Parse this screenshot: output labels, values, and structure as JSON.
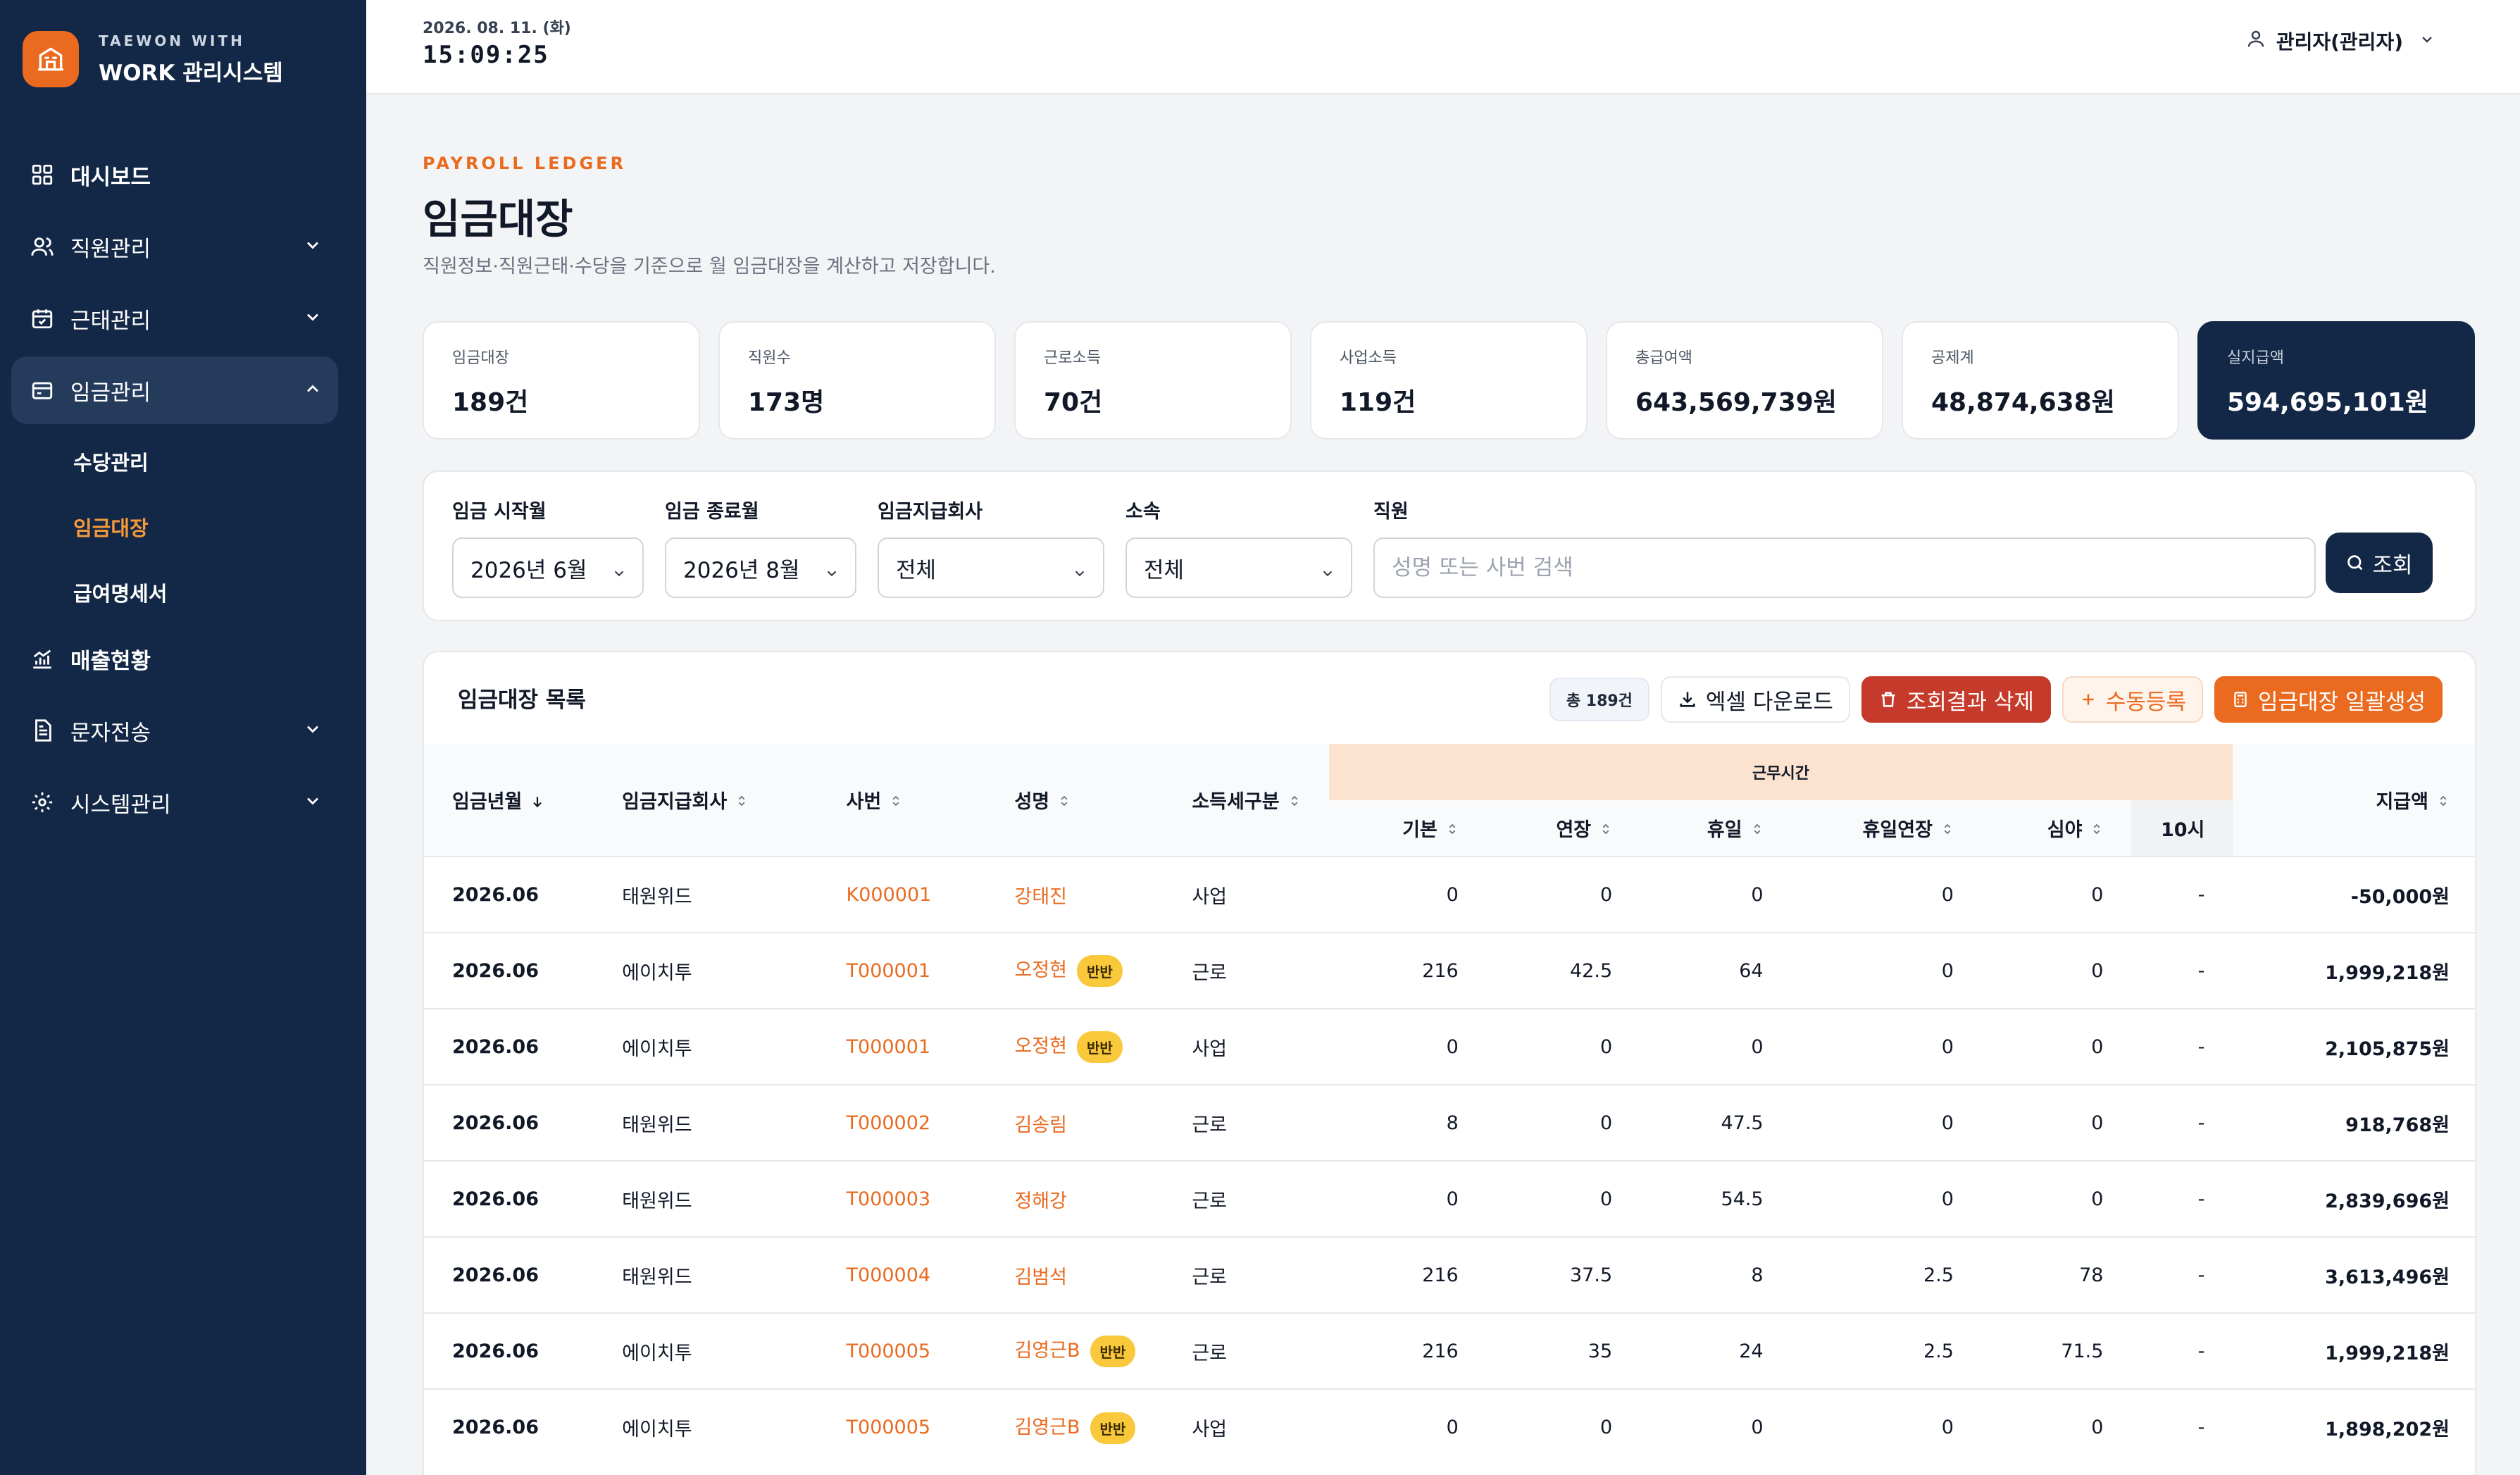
{
  "brand": {
    "sub": "TAEWON WITH",
    "title": "WORK 관리시스템"
  },
  "nav": {
    "dashboard": "대시보드",
    "employees": "직원관리",
    "attendance": "근태관리",
    "payroll": "임금관리",
    "payroll_sub": [
      "수당관리",
      "임금대장",
      "급여명세서"
    ],
    "sales": "매출현황",
    "sms": "문자전송",
    "system": "시스템관리"
  },
  "topbar": {
    "date": "2026. 08. 11. (화)",
    "time": "15:09:25",
    "user": "관리자(관리자)"
  },
  "header": {
    "eyebrow": "PAYROLL LEDGER",
    "title": "임금대장",
    "desc": "직원정보·직원근태·수당을 기준으로 월 임금대장을 계산하고 저장합니다."
  },
  "stats": [
    {
      "label": "임금대장",
      "value": "189건"
    },
    {
      "label": "직원수",
      "value": "173명"
    },
    {
      "label": "근로소득",
      "value": "70건"
    },
    {
      "label": "사업소득",
      "value": "119건"
    },
    {
      "label": "총급여액",
      "value": "643,569,739원"
    },
    {
      "label": "공제계",
      "value": "48,874,638원"
    },
    {
      "label": "실지급액",
      "value": "594,695,101원"
    }
  ],
  "filters": {
    "start_label": "임금 시작월",
    "start_value": "2026년 6월",
    "end_label": "임금 종료월",
    "end_value": "2026년 8월",
    "company_label": "임금지급회사",
    "company_value": "전체",
    "dept_label": "소속",
    "dept_value": "전체",
    "emp_label": "직원",
    "emp_placeholder": "성명 또는 사번 검색",
    "search_label": "조회"
  },
  "table": {
    "title": "임금대장 목록",
    "count": "총 189건",
    "btn_excel": "엑셀 다운로드",
    "btn_delete": "조회결과 삭제",
    "btn_manual": "수동등록",
    "btn_generate": "임금대장 일괄생성",
    "columns": {
      "ym": "임금년월",
      "company": "임금지급회사",
      "id": "사번",
      "name": "성명",
      "type": "소득세구분",
      "group": "근무시간",
      "base": "기본",
      "ot": "연장",
      "holiday": "휴일",
      "holiday_ot": "휴일연장",
      "night": "심야",
      "ten": "10시",
      "pay": "지급액"
    },
    "half_badge": "반반",
    "rows": [
      {
        "ym": "2026.06",
        "company": "태원위드",
        "id": "K000001",
        "name": "강태진",
        "half": false,
        "type": "사업",
        "base": "0",
        "ot": "0",
        "holiday": "0",
        "holiday_ot": "0",
        "night": "0",
        "ten": "-",
        "pay": "-50,000원"
      },
      {
        "ym": "2026.06",
        "company": "에이치투",
        "id": "T000001",
        "name": "오정현",
        "half": true,
        "type": "근로",
        "base": "216",
        "ot": "42.5",
        "holiday": "64",
        "holiday_ot": "0",
        "night": "0",
        "ten": "-",
        "pay": "1,999,218원"
      },
      {
        "ym": "2026.06",
        "company": "에이치투",
        "id": "T000001",
        "name": "오정현",
        "half": true,
        "type": "사업",
        "base": "0",
        "ot": "0",
        "holiday": "0",
        "holiday_ot": "0",
        "night": "0",
        "ten": "-",
        "pay": "2,105,875원"
      },
      {
        "ym": "2026.06",
        "company": "태원위드",
        "id": "T000002",
        "name": "김송림",
        "half": false,
        "type": "근로",
        "base": "8",
        "ot": "0",
        "holiday": "47.5",
        "holiday_ot": "0",
        "night": "0",
        "ten": "-",
        "pay": "918,768원"
      },
      {
        "ym": "2026.06",
        "company": "태원위드",
        "id": "T000003",
        "name": "정해강",
        "half": false,
        "type": "근로",
        "base": "0",
        "ot": "0",
        "holiday": "54.5",
        "holiday_ot": "0",
        "night": "0",
        "ten": "-",
        "pay": "2,839,696원"
      },
      {
        "ym": "2026.06",
        "company": "태원위드",
        "id": "T000004",
        "name": "김범석",
        "half": false,
        "type": "근로",
        "base": "216",
        "ot": "37.5",
        "holiday": "8",
        "holiday_ot": "2.5",
        "night": "78",
        "ten": "-",
        "pay": "3,613,496원"
      },
      {
        "ym": "2026.06",
        "company": "에이치투",
        "id": "T000005",
        "name": "김영근B",
        "half": true,
        "type": "근로",
        "base": "216",
        "ot": "35",
        "holiday": "24",
        "holiday_ot": "2.5",
        "night": "71.5",
        "ten": "-",
        "pay": "1,999,218원"
      },
      {
        "ym": "2026.06",
        "company": "에이치투",
        "id": "T000005",
        "name": "김영근B",
        "half": true,
        "type": "사업",
        "base": "0",
        "ot": "0",
        "holiday": "0",
        "holiday_ot": "0",
        "night": "0",
        "ten": "-",
        "pay": "1,898,202원"
      }
    ]
  }
}
